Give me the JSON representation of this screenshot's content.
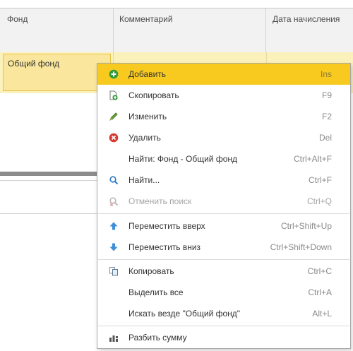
{
  "table": {
    "columns": [
      "Фонд",
      "Комментарий",
      "Дата начисления"
    ],
    "rows": [
      {
        "fund": "Общий фонд",
        "comment": "",
        "date": ""
      }
    ]
  },
  "context_menu": {
    "items": [
      {
        "label": "Добавить",
        "shortcut": "Ins",
        "icon": "add-icon"
      },
      {
        "label": "Скопировать",
        "shortcut": "F9",
        "icon": "copy-document-icon"
      },
      {
        "label": "Изменить",
        "shortcut": "F2",
        "icon": "pencil-icon"
      },
      {
        "label": "Удалить",
        "shortcut": "Del",
        "icon": "delete-icon"
      },
      {
        "label": "Найти: Фонд - Общий фонд",
        "shortcut": "Ctrl+Alt+F",
        "icon": ""
      },
      {
        "label": "Найти...",
        "shortcut": "Ctrl+F",
        "icon": "search-icon"
      },
      {
        "label": "Отменить поиск",
        "shortcut": "Ctrl+Q",
        "icon": "cancel-search-icon"
      },
      {
        "label": "Переместить вверх",
        "shortcut": "Ctrl+Shift+Up",
        "icon": "arrow-up-icon"
      },
      {
        "label": "Переместить вниз",
        "shortcut": "Ctrl+Shift+Down",
        "icon": "arrow-down-icon"
      },
      {
        "label": "Копировать",
        "shortcut": "Ctrl+C",
        "icon": "copy-icon"
      },
      {
        "label": "Выделить все",
        "shortcut": "Ctrl+A",
        "icon": ""
      },
      {
        "label": "Искать везде \"Общий фонд\"",
        "shortcut": "Alt+L",
        "icon": ""
      },
      {
        "label": "Разбить сумму",
        "shortcut": "",
        "icon": "split-sum-icon"
      }
    ],
    "highlight_color": "#f8ca1f"
  }
}
